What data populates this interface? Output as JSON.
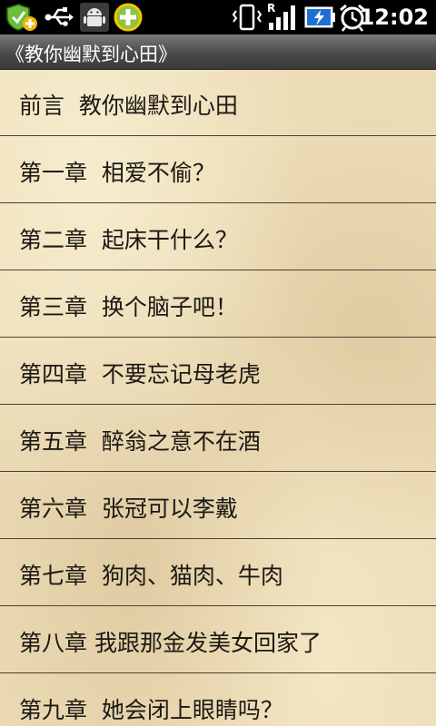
{
  "status_bar": {
    "time": "12:02",
    "icons": [
      "shield-plus-icon",
      "usb-icon",
      "android-icon",
      "add-circle-icon",
      "vibrate-icon",
      "signal-icon",
      "battery-charging-icon",
      "alarm-icon"
    ],
    "roaming_letter": "R"
  },
  "title_bar": {
    "title": "《教你幽默到心田》"
  },
  "chapters": [
    {
      "label": "前言  教你幽默到心田"
    },
    {
      "label": "第一章  相爱不偷？"
    },
    {
      "label": "第二章  起床干什么？"
    },
    {
      "label": "第三章  换个脑子吧！"
    },
    {
      "label": "第四章  不要忘记母老虎"
    },
    {
      "label": "第五章  醉翁之意不在酒"
    },
    {
      "label": "第六章  张冠可以李戴"
    },
    {
      "label": "第七章  狗肉、猫肉、牛肉"
    },
    {
      "label": "第八章 我跟那金发美女回家了"
    },
    {
      "label": "第九章  她会闭上眼睛吗？"
    }
  ],
  "colors": {
    "paper": "#ecdcb6",
    "text": "#1c1814",
    "separator": "#4a4033"
  }
}
